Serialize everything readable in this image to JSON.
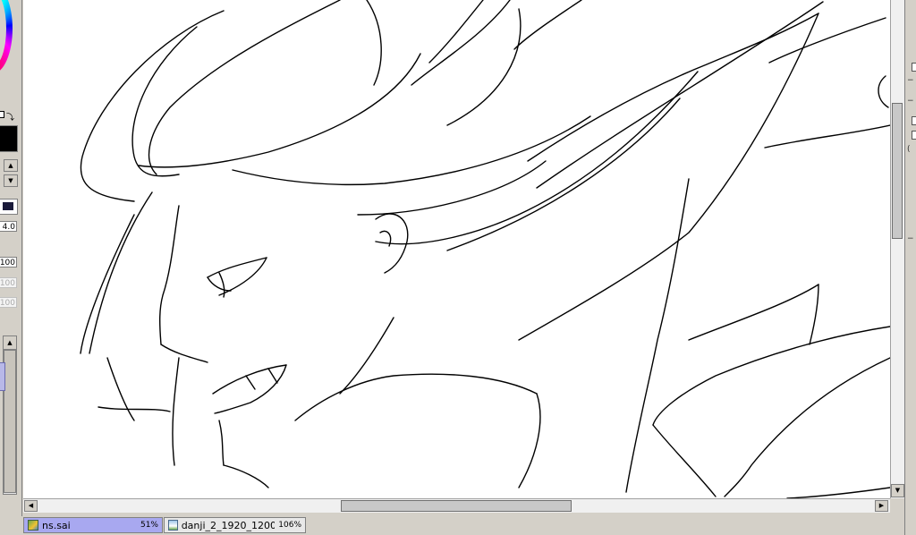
{
  "left_panel": {
    "brush_size_value": "4.0",
    "density_value": "100",
    "min_size_value": "100",
    "min_density_value": "100",
    "icons": [
      "color-wheel",
      "swap-colors-icon",
      "spin-up-icon",
      "spin-down-icon"
    ]
  },
  "canvas": {
    "content": "line-art-sketch",
    "stroke_color": "#000000",
    "background_color": "#ffffff"
  },
  "tabs": [
    {
      "name": "ns.sai",
      "zoom": "51%",
      "active": true
    },
    {
      "name": "danji_2_1920_1200 ...",
      "zoom": "106%",
      "active": false
    }
  ],
  "colors": {
    "panel_bg": "#d4d0c8",
    "active_tab": "#a8a8f0",
    "foreground": "#000000"
  }
}
